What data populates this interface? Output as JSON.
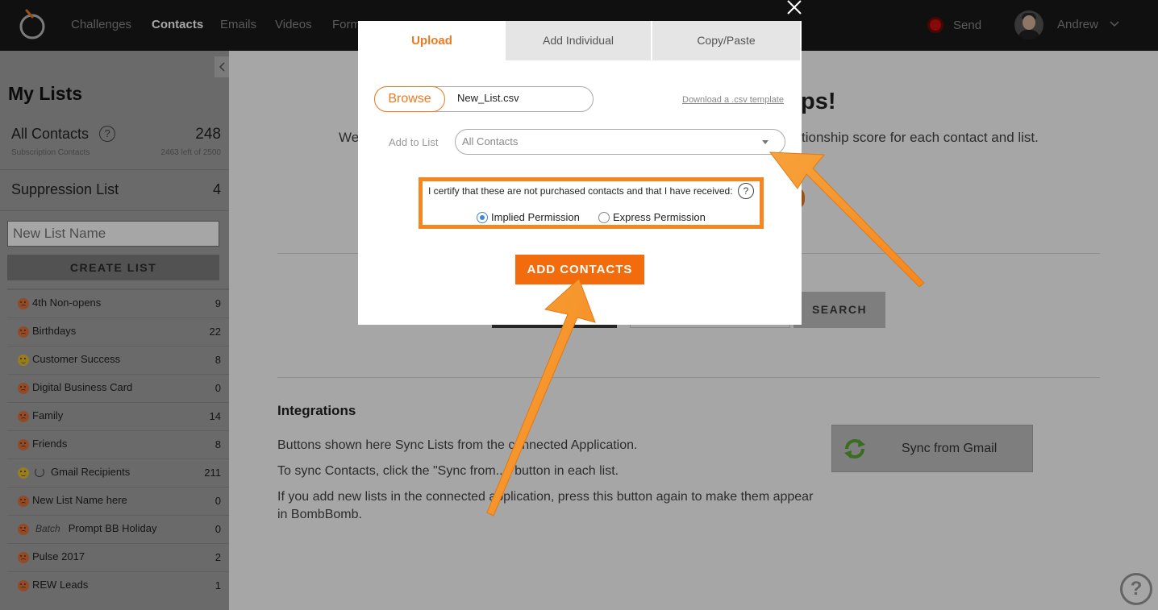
{
  "nav": {
    "links": [
      "Challenges",
      "Contacts",
      "Emails",
      "Videos",
      "Forms"
    ],
    "active": "Contacts",
    "send_label": "Send",
    "user_name": "Andrew"
  },
  "sidebar": {
    "title": "My Lists",
    "all_contacts": {
      "label": "All Contacts",
      "count": "248",
      "sub": "Subscription Contacts",
      "remaining": "2463 left of 2500"
    },
    "suppression": {
      "label": "Suppression List",
      "count": "4"
    },
    "new_list_placeholder": "New List Name",
    "create_label": "CREATE LIST",
    "lists": [
      {
        "name": "4th Non-opens",
        "count": "9",
        "face": "orange"
      },
      {
        "name": "Birthdays",
        "count": "22",
        "face": "orange"
      },
      {
        "name": "Customer Success",
        "count": "8",
        "face": "yellow"
      },
      {
        "name": "Digital Business Card",
        "count": "0",
        "face": "orange"
      },
      {
        "name": "Family",
        "count": "14",
        "face": "orange"
      },
      {
        "name": "Friends",
        "count": "8",
        "face": "orange"
      },
      {
        "name": "Gmail Recipients",
        "count": "211",
        "face": "yellow"
      },
      {
        "name": "New List Name here",
        "count": "0",
        "face": "orange"
      },
      {
        "tag": "Batch",
        "name": "Prompt BB Holiday",
        "count": "0",
        "face": "orange"
      },
      {
        "name": "Pulse 2017",
        "count": "2",
        "face": "orange"
      },
      {
        "name": "REW Leads",
        "count": "1",
        "face": "orange"
      }
    ]
  },
  "main": {
    "heading_tail": "ps!",
    "text_left": "We",
    "text_right": "tionship score for each contact and list.",
    "search_label": "SEARCH",
    "integrations_title": "Integrations",
    "integrations_p1": "Buttons shown here Sync Lists from the connected Application.",
    "integrations_p2": "To sync Contacts, click the \"Sync from...\" button in each list.",
    "integrations_p3": "If you add new lists in the connected application, press this button again to make them appear in BombBomb.",
    "sync_label": "Sync from Gmail",
    "help_glyph": "?"
  },
  "modal": {
    "tabs": [
      "Upload",
      "Add Individual",
      "Copy/Paste"
    ],
    "browse_label": "Browse",
    "file_name": "New_List.csv",
    "template_link": "Download a .csv template",
    "add_to_label": "Add to List",
    "list_value": "All Contacts",
    "certify_text": "I certify that these are not purchased contacts and that I have received:",
    "help_glyph": "?",
    "radio_implied": "Implied Permission",
    "radio_express": "Express Permission",
    "submit_label": "ADD CONTACTS"
  },
  "colors": {
    "accent": "#f26b0c",
    "highlight": "#f4871f",
    "nav_bg": "#1a1a1a",
    "sidebar_bg": "#a3a3a3",
    "radio_selected": "#3e86d8"
  }
}
